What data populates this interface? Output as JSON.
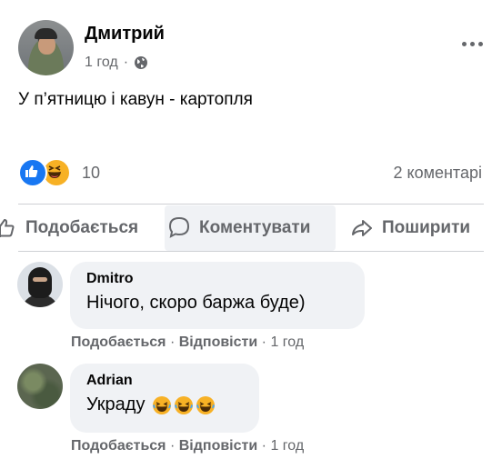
{
  "post": {
    "author": "Дмитрий",
    "time": "1 год",
    "separator": "·",
    "text": "У п’ятницю і кавун - картопля",
    "reactions": {
      "icons": [
        "like-icon",
        "haha-icon"
      ],
      "count": "10"
    },
    "comments_count": "2 коментарі"
  },
  "actions": {
    "like": "Подобається",
    "comment": "Коментувати",
    "share": "Поширити"
  },
  "comments": [
    {
      "name": "Dmitro",
      "text": "Нічого, скоро баржа буде)",
      "like": "Подобається",
      "reply": "Відповісти",
      "time": "1 год",
      "sep": "·"
    },
    {
      "name": "Adrian",
      "text": "Украду",
      "emojis": [
        "laughing-crying-emoji",
        "laughing-crying-emoji",
        "laughing-crying-emoji"
      ],
      "like": "Подобається",
      "reply": "Відповісти",
      "time": "1 год",
      "sep": "·"
    }
  ],
  "colors": {
    "accent": "#1877f2",
    "secondary_text": "#65676b",
    "bubble": "#f0f2f5"
  }
}
